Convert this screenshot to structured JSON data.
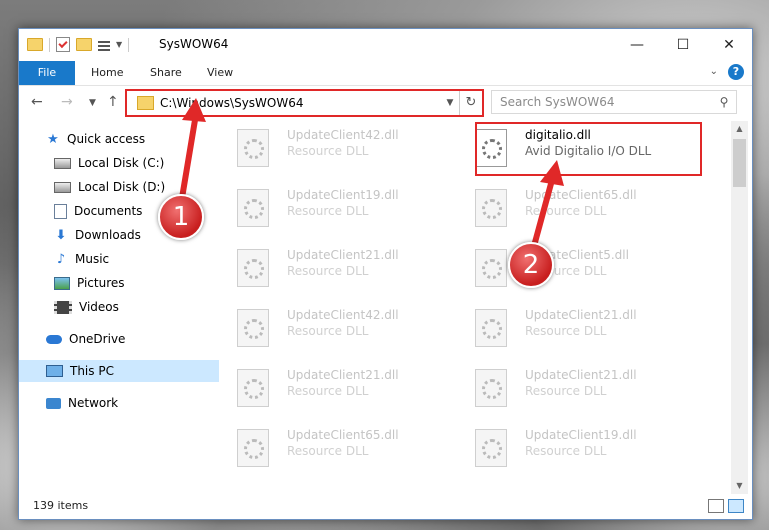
{
  "window": {
    "title": "SysWOW64",
    "controls": {
      "minimize": "—",
      "maximize": "☐",
      "close": "✕"
    }
  },
  "ribbon": {
    "tabs": [
      "File",
      "Home",
      "Share",
      "View"
    ],
    "help": "?"
  },
  "navbar": {
    "address": "C:\\Windows\\SysWOW64",
    "search_placeholder": "Search SysWOW64"
  },
  "sidebar": {
    "items": [
      {
        "label": "Quick access",
        "icon": "star-icon"
      },
      {
        "label": "Local Disk (C:)",
        "icon": "disk-icon",
        "pinned": true
      },
      {
        "label": "Local Disk (D:)",
        "icon": "disk-icon",
        "pinned": true
      },
      {
        "label": "Documents",
        "icon": "documents-icon",
        "pinned": true
      },
      {
        "label": "Downloads",
        "icon": "downloads-icon",
        "pinned": true
      },
      {
        "label": "Music",
        "icon": "music-icon",
        "pinned": true
      },
      {
        "label": "Pictures",
        "icon": "pictures-icon",
        "pinned": true
      },
      {
        "label": "Videos",
        "icon": "videos-icon",
        "pinned": true
      },
      {
        "label": "OneDrive",
        "icon": "onedrive-icon"
      },
      {
        "label": "This PC",
        "icon": "pc-icon",
        "selected": true
      },
      {
        "label": "Network",
        "icon": "network-icon"
      }
    ]
  },
  "files": {
    "left": [
      {
        "name": "UpdateClient42.dll",
        "type": "Resource DLL"
      },
      {
        "name": "UpdateClient19.dll",
        "type": "Resource DLL"
      },
      {
        "name": "UpdateClient21.dll",
        "type": "Resource DLL"
      },
      {
        "name": "UpdateClient42.dll",
        "type": "Resource DLL"
      },
      {
        "name": "UpdateClient21.dll",
        "type": "Resource DLL"
      },
      {
        "name": "UpdateClient65.dll",
        "type": "Resource DLL"
      }
    ],
    "right": [
      {
        "name": "digitalio.dll",
        "type": "Avid Digitalio I/O DLL"
      },
      {
        "name": "UpdateClient65.dll",
        "type": "Resource DLL"
      },
      {
        "name": "UpdateClient5.dll",
        "type": "Resource DLL"
      },
      {
        "name": "UpdateClient21.dll",
        "type": "Resource DLL"
      },
      {
        "name": "UpdateClient21.dll",
        "type": "Resource DLL"
      },
      {
        "name": "UpdateClient19.dll",
        "type": "Resource DLL"
      }
    ]
  },
  "status": {
    "item_count": "139 items"
  },
  "annotations": {
    "step1": "1",
    "step2": "2",
    "color": "#e02828"
  }
}
